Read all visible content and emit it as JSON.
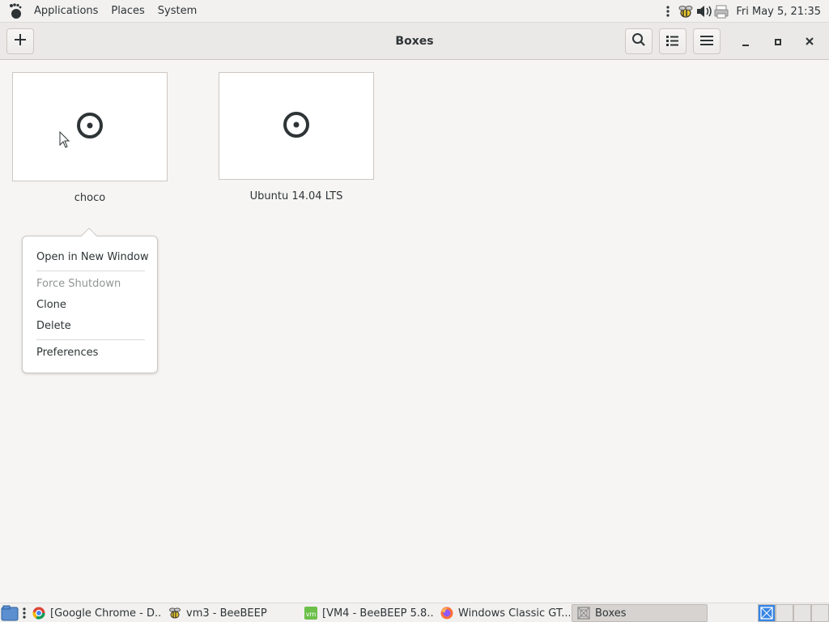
{
  "top_panel": {
    "menus": [
      "Applications",
      "Places",
      "System"
    ],
    "clock": "Fri May  5, 21:35"
  },
  "header": {
    "title": "Boxes",
    "new_icon": "plus-icon",
    "search_icon": "search-icon",
    "view_icon": "list-view-icon",
    "menu_icon": "hamburger-icon"
  },
  "boxes": [
    {
      "name": "choco",
      "icon": "target-icon"
    },
    {
      "name": "Ubuntu 14.04 LTS",
      "icon": "target-icon"
    }
  ],
  "context_menu": {
    "open_new_window": "Open in New Window",
    "force_shutdown": "Force Shutdown",
    "clone": "Clone",
    "delete": "Delete",
    "preferences": "Preferences"
  },
  "taskbar": {
    "tasks": [
      {
        "label": "[Google Chrome - D...",
        "icon": "chrome-icon"
      },
      {
        "label": "vm3 - BeeBEEP",
        "icon": "beebeep-icon"
      },
      {
        "label": "[VM4 - BeeBEEP 5.8...",
        "icon": "vm-icon"
      },
      {
        "label": "Windows Classic GT...",
        "icon": "firefox-icon"
      },
      {
        "label": "Boxes",
        "icon": "boxes-icon"
      }
    ]
  },
  "colors": {
    "accent": "#3584e4",
    "panel_bg": "#f2f1f0",
    "content_bg": "#f6f5f4"
  }
}
